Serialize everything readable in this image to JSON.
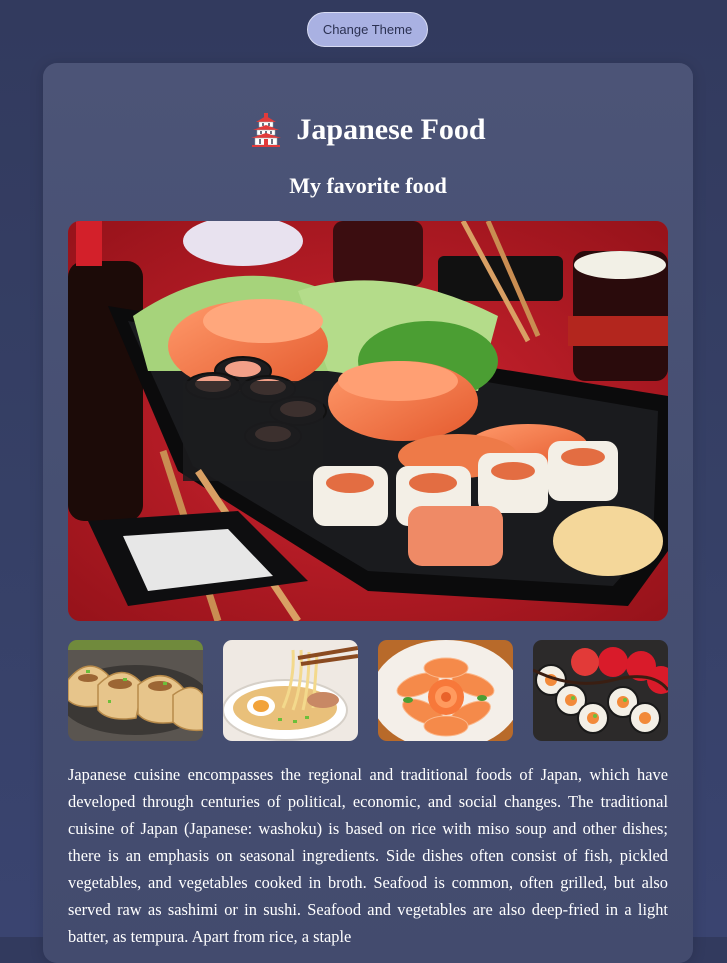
{
  "header": {
    "theme_button_label": "Change Theme"
  },
  "card": {
    "title": "Japanese Food",
    "title_icon": "pagoda-icon",
    "subtitle": "My favorite food",
    "hero_image": "sushi-boat-photo",
    "thumbnails": [
      {
        "name": "gyoza-photo"
      },
      {
        "name": "ramen-photo"
      },
      {
        "name": "salmon-rose-photo"
      },
      {
        "name": "sushi-rolls-photo"
      }
    ],
    "description": "Japanese cuisine encompasses the regional and traditional foods of Japan, which have developed through centuries of political, economic, and social changes. The traditional cuisine of Japan (Japanese: washoku) is based on rice with miso soup and other dishes; there is an emphasis on seasonal ingredients. Side dishes often consist of fish, pickled vegetables, and vegetables cooked in broth. Seafood is common, often grilled, but also served raw as sashimi or in sushi. Seafood and vegetables are also deep-fried in a light batter, as tempura. Apart from rice, a staple"
  },
  "colors": {
    "background": "#343d63",
    "card": "#4a5275",
    "button": "#a9b1e2",
    "text": "#ffffff"
  }
}
